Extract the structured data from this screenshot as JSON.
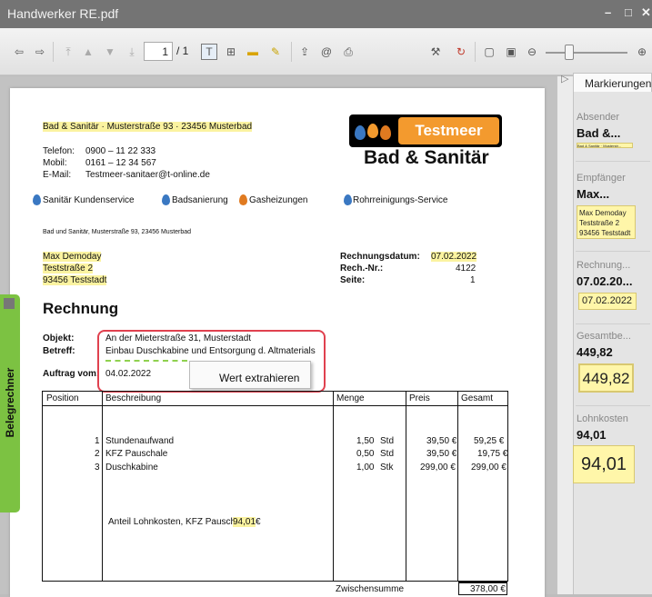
{
  "window": {
    "title": "Handwerker RE.pdf",
    "controls": [
      "–",
      "□",
      "✕"
    ]
  },
  "toolbar": {
    "page_current": "1",
    "page_total": "/ 1"
  },
  "document": {
    "sender_line": "Bad & Sanitär · Musterstraße 93 · 23456 Musterbad",
    "contact": {
      "phone_label": "Telefon:",
      "phone": "0900 – 11 22 333",
      "mobile_label": "Mobil:",
      "mobile": "0161 – 12 34 567",
      "email_label": "E-Mail:",
      "email": "Testmeer-sanitaer@t-online.de"
    },
    "logo": {
      "brand": "Testmeer",
      "subtitle": "Bad & Sanitär"
    },
    "services": [
      "Sanitär Kundenservice",
      "Badsanierung",
      "Gasheizungen",
      "Rohrreinigungs-Service"
    ],
    "return_address": "Bad und Sanitär, Musterstraße 93, 23456 Musterbad",
    "recipient": [
      "Max Demoday",
      "Teststraße 2",
      "93456 Teststadt"
    ],
    "meta": {
      "date_label": "Rechnungsdatum:",
      "date": "07.02.2022",
      "number_label": "Rech.-Nr.:",
      "number": "4122",
      "page_label": "Seite:",
      "page": "1"
    },
    "heading": "Rechnung",
    "objekt_label": "Objekt:",
    "objekt": "An der Mieterstraße 31, Musterstadt",
    "betreff_label": "Betreff:",
    "betreff": "Einbau Duschkabine und Entsorgung d. Altmaterials",
    "auftrag_label": "Auftrag vom:",
    "auftrag": "04.02.2022",
    "context_menu": "Wert extrahieren",
    "table": {
      "headers": [
        "Position",
        "Beschreibung",
        "Menge",
        "Preis",
        "Gesamt"
      ],
      "rows": [
        {
          "pos": "1",
          "desc": "Stundenaufwand",
          "qty": "1,50",
          "unit": "Std",
          "price": "39,50 €",
          "total": "59,25 €"
        },
        {
          "pos": "2",
          "desc": "KFZ Pauschale",
          "qty": "0,50",
          "unit": "Std",
          "price": "39,50 €",
          "total": "19,75 €"
        },
        {
          "pos": "3",
          "desc": "Duschkabine",
          "qty": "1,00",
          "unit": "Stk",
          "price": "299,00 €",
          "total": "299,00 €"
        }
      ],
      "note_label": "Anteil Lohnkosten, KFZ Pauschale",
      "note_value": "94,01",
      "note_currency": "€",
      "subtotal_label": "Zwischensumme",
      "subtotal": "378,00 €"
    }
  },
  "sidetab": {
    "label": "Belegrechner"
  },
  "panel": {
    "tab": "Markierungen",
    "items": [
      {
        "label": "Absender",
        "value": "Bad &...",
        "thumb": "Bad & Sanitär · Musterstr..."
      },
      {
        "label": "Empfänger",
        "value": "Max...",
        "thumb": [
          "Max Demoday",
          "Teststraße 2",
          "93456 Teststadt"
        ]
      },
      {
        "label": "Rechnung...",
        "value": "07.02.20...",
        "thumb": "07.02.2022"
      },
      {
        "label": "Gesamtbe...",
        "value": "449,82",
        "thumb": "449,82"
      },
      {
        "label": "Lohnkosten",
        "value": "94,01",
        "thumb": "94,01"
      }
    ]
  },
  "colors": {
    "highlight": "#fbf3a0",
    "sidetab": "#7cc242",
    "selection_box": "#e0414f",
    "logo_orange": "#f39a2e"
  }
}
